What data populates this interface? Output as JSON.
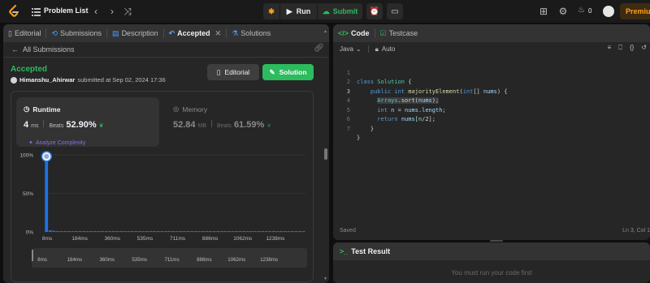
{
  "topbar": {
    "problem_list_label": "Problem List",
    "run_label": "Run",
    "submit_label": "Submit",
    "streak_count": "0",
    "premium_label": "Premium"
  },
  "left_tabs": [
    {
      "label": "Editorial",
      "icon": "book-icon"
    },
    {
      "label": "Submissions",
      "icon": "history-icon"
    },
    {
      "label": "Description",
      "icon": "document-icon"
    },
    {
      "label": "Accepted",
      "icon": "undo-icon"
    },
    {
      "label": "Solutions",
      "icon": "flask-icon"
    }
  ],
  "submission": {
    "back_label": "All Submissions",
    "status": "Accepted",
    "author": "Himanshu_Ahirwar",
    "submitted_text": "submitted at Sep 02, 2024 17:36",
    "editorial_button": "Editorial",
    "solution_button": "Solution"
  },
  "runtime": {
    "title": "Runtime",
    "value": "4",
    "unit": "ms",
    "beats_label": "Beats",
    "beats_pct": "52.90%",
    "analyze_label": "Analyze Complexity"
  },
  "memory": {
    "title": "Memory",
    "value": "52.84",
    "unit": "MB",
    "beats_label": "Beats",
    "beats_pct": "61.59%"
  },
  "chart_data": {
    "type": "bar",
    "x_tick_labels": [
      "8ms",
      "184ms",
      "360ms",
      "535ms",
      "711ms",
      "886ms",
      "1062ms",
      "1238ms"
    ],
    "y_tick_labels": [
      "100%",
      "50%",
      "0%"
    ],
    "ylim": [
      0,
      100
    ],
    "values": [
      98,
      2,
      1.5,
      1,
      1,
      1,
      1,
      1,
      1,
      1,
      1,
      1,
      1,
      1,
      1,
      1,
      1,
      1,
      1,
      1,
      1,
      1,
      1,
      1,
      1,
      1,
      1,
      1,
      1,
      1,
      1,
      1,
      1,
      1,
      1,
      1,
      1,
      1,
      1,
      1,
      1,
      1,
      1,
      1,
      1,
      1,
      1,
      1,
      1,
      1,
      1,
      1,
      1,
      1,
      1,
      1,
      1,
      1,
      1,
      1,
      1,
      1,
      1,
      1,
      1,
      1,
      1,
      1,
      1,
      1
    ],
    "marker_index": 0,
    "bar_color": "#1a73e8",
    "grid": true
  },
  "right_tabs": [
    {
      "label": "Code",
      "icon": "code-icon"
    },
    {
      "label": "Testcase",
      "icon": "checkbox-icon"
    }
  ],
  "editor": {
    "language": "Java",
    "mode": "Auto",
    "saved_label": "Saved",
    "cursor_pos": "Ln 3, Col 1"
  },
  "code_lines": [
    {
      "n": "1",
      "text": "class Solution {"
    },
    {
      "n": "2",
      "text": "    public int majorityElement(int[] nums) {"
    },
    {
      "n": "3",
      "text": "      Arrays.sort(nums);"
    },
    {
      "n": "4",
      "text": "      int n = nums.length;"
    },
    {
      "n": "5",
      "text": "      return nums[n/2];"
    },
    {
      "n": "6",
      "text": "    }"
    },
    {
      "n": "7",
      "text": "}"
    }
  ],
  "test_result": {
    "title": "Test Result",
    "message": "You must run your code first"
  },
  "colors": {
    "accent_green": "#2cbb5d",
    "accent_orange": "#ffa116",
    "purple": "#8d6fe0"
  }
}
